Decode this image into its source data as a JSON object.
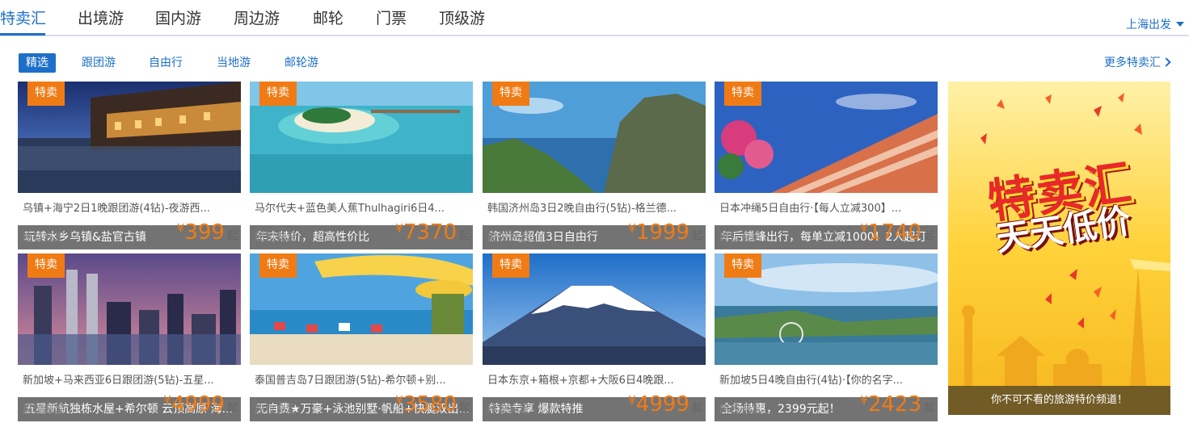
{
  "topnav": {
    "tabs": [
      "特卖汇",
      "出境游",
      "国内游",
      "周边游",
      "邮轮",
      "门票",
      "顶级游"
    ],
    "departure": "上海出发"
  },
  "subnav": {
    "tabs": [
      "精选",
      "跟团游",
      "自由行",
      "当地游",
      "邮轮游"
    ],
    "more": "更多特卖汇"
  },
  "cards": [
    {
      "badge": "特卖",
      "caption": "玩转水乡乌镇&盐官古镇",
      "title": "乌镇+海宁2日1晚跟团游(4钻)-夜游西...",
      "status": "席位充足",
      "currency": "¥",
      "price": "399",
      "suffix": "起"
    },
    {
      "badge": "特卖",
      "caption": "年末特价，超高性价比",
      "title": "马尔代夫+蓝色美人蕉Thulhagiri6日4...",
      "status": "席位充足",
      "currency": "¥",
      "price": "7370",
      "suffix": "起"
    },
    {
      "badge": "特卖",
      "caption": "济州岛超值3日自由行",
      "title": "韩国济州岛3日2晚自由行(5钻)-格兰德...",
      "status": "席位充足",
      "currency": "¥",
      "price": "1999",
      "suffix": "起"
    },
    {
      "badge": "特卖",
      "caption": "年后错峰出行，每单立减1000！2人起订",
      "title": "日本冲绳5日自由行·【每人立减300】...",
      "status": "席位充足",
      "currency": "¥",
      "price": "1740",
      "suffix": "起"
    },
    {
      "badge": "特卖",
      "caption": "五星新航独栋水屋+希尔顿 云顶高原 海...",
      "title": "新加坡+马来西亚6日跟团游(5钻)-五星...",
      "status": "席位充足",
      "currency": "¥",
      "price": "4999",
      "suffix": "起"
    },
    {
      "badge": "特卖",
      "caption": "无自费★万豪+泳池别墅·帆船+快艇双出...",
      "title": "泰国普吉岛7日跟团游(5钻)-希尔顿+别...",
      "status": "席位充足",
      "currency": "¥",
      "price": "3580",
      "suffix": "起"
    },
    {
      "badge": "特卖",
      "caption": "特卖专享 爆款特推",
      "title": "日本东京+箱根+京都+大阪6日4晚跟...",
      "status": "席位充足",
      "currency": "¥",
      "price": "4999",
      "suffix": "起"
    },
    {
      "badge": "特卖",
      "caption": "全场特惠，2399元起！",
      "title": "新加坡5日4晚自由行(4钻)·【你的名字...",
      "status": "席位充足",
      "currency": "¥",
      "price": "2423",
      "suffix": "起"
    }
  ],
  "promo": {
    "title": "特卖汇",
    "subtitle": "天天低价",
    "footer": "你不可不看的旅游特价频道！"
  },
  "colors": {
    "accent": "#1d6fc9",
    "price": "#f07b14",
    "badge": "#f07b14",
    "promo_bg": "#ffd23a"
  }
}
